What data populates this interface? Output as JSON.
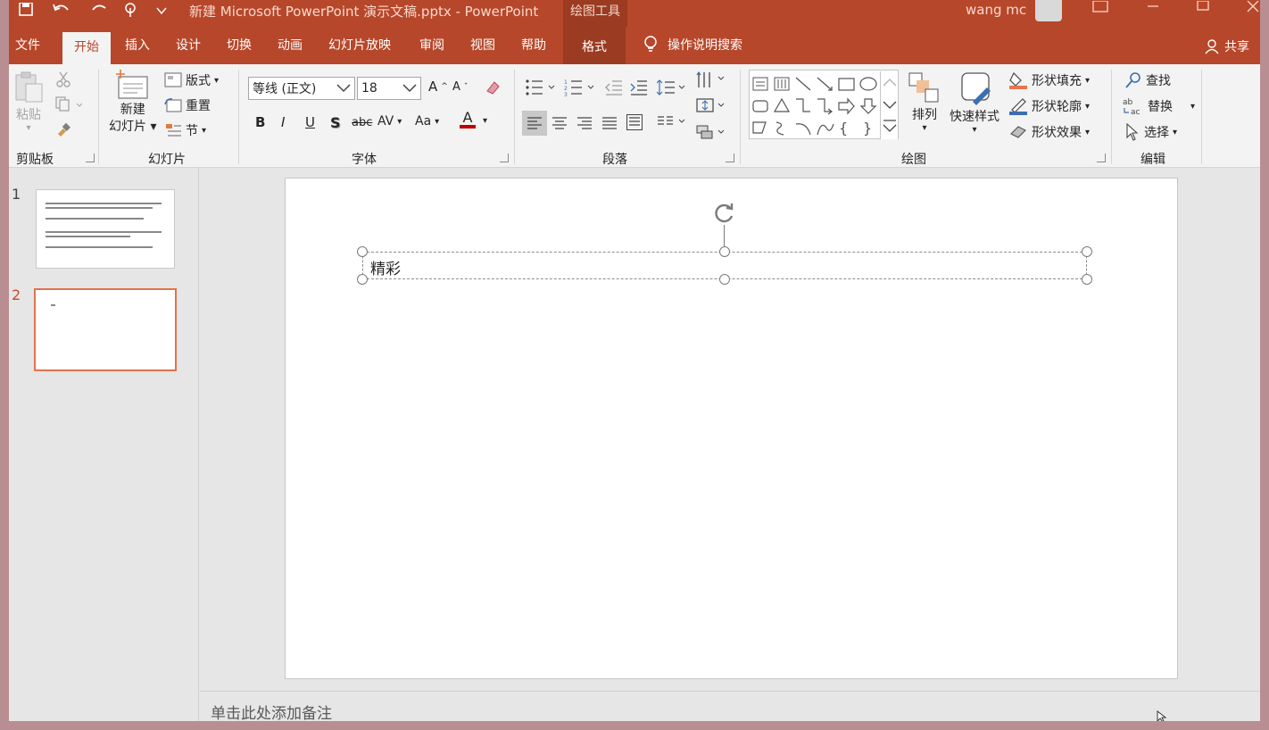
{
  "window": {
    "title": "新建 Microsoft PowerPoint 演示文稿.pptx  -  PowerPoint",
    "context_tab": "绘图工具",
    "user": "wang mc"
  },
  "tabs": [
    {
      "label": "文件"
    },
    {
      "label": "开始"
    },
    {
      "label": "插入"
    },
    {
      "label": "设计"
    },
    {
      "label": "切换"
    },
    {
      "label": "动画"
    },
    {
      "label": "幻灯片放映"
    },
    {
      "label": "审阅"
    },
    {
      "label": "视图"
    },
    {
      "label": "帮助"
    },
    {
      "label": "格式"
    }
  ],
  "tell_me": "操作说明搜索",
  "share": "共享",
  "ribbon": {
    "clipboard": {
      "label": "剪贴板",
      "paste": "粘贴"
    },
    "slides": {
      "label": "幻灯片",
      "new_slide_1": "新建",
      "new_slide_2": "幻灯片",
      "layout": "版式",
      "reset": "重置",
      "section": "节"
    },
    "font": {
      "label": "字体",
      "font_name": "等线 (正文)",
      "font_size": "18"
    },
    "paragraph": {
      "label": "段落"
    },
    "drawing": {
      "label": "绘图",
      "arrange": "排列",
      "quick_styles": "快速样式",
      "shape_fill": "形状填充",
      "shape_outline": "形状轮廓",
      "shape_effects": "形状效果"
    },
    "editing": {
      "label": "编辑",
      "find": "查找",
      "replace": "替换",
      "select": "选择"
    }
  },
  "thumbnails": [
    {
      "number": "1"
    },
    {
      "number": "2"
    }
  ],
  "slide": {
    "textbox_text": "精彩"
  },
  "notes_placeholder": "单击此处添加备注",
  "colors": {
    "accent": "#b7472a",
    "context": "#9b3b21",
    "selection": "#e0734f"
  }
}
